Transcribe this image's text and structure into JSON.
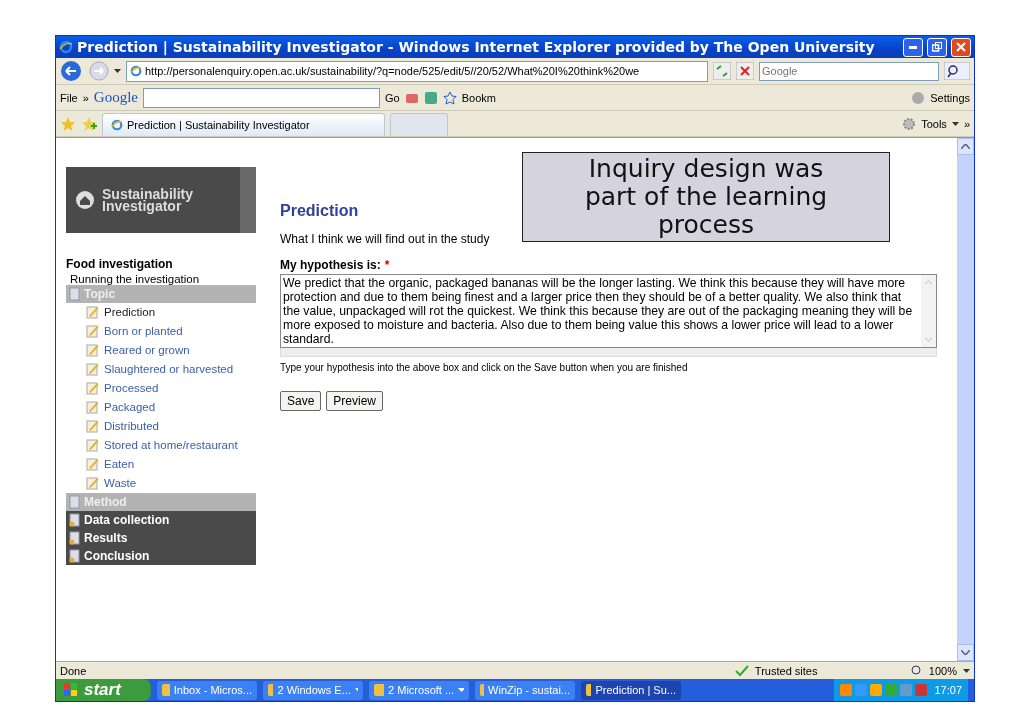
{
  "window": {
    "title": "Prediction | Sustainability Investigator - Windows Internet Explorer provided by The Open University"
  },
  "address_bar": {
    "url": "http://personalenquiry.open.ac.uk/sustainability/?q=node/525/edit/5//20/52/What%20I%20think%20we"
  },
  "search_field": {
    "placeholder": "Google"
  },
  "google_toolbar": {
    "menu": "File",
    "chevron": "»",
    "logo": "Google",
    "go": "Go",
    "bookmarks": "Bookm",
    "settings": "Settings"
  },
  "tabs": [
    {
      "label": "Prediction | Sustainability Investigator",
      "selected": true
    }
  ],
  "command_bar": {
    "tools": "Tools",
    "chevron": "»"
  },
  "sidebar": {
    "logo": "Sustainability Investigator",
    "project": "Food investigation",
    "subtitle": "Running the investigation",
    "sections": [
      {
        "label": "Topic",
        "kind": "open",
        "children": [
          {
            "label": "Prediction",
            "selected": true
          },
          {
            "label": "Born or planted",
            "selected": false
          },
          {
            "label": "Reared or grown",
            "selected": false
          },
          {
            "label": "Slaughtered or harvested",
            "selected": false
          },
          {
            "label": "Processed",
            "selected": false
          },
          {
            "label": "Packaged",
            "selected": false
          },
          {
            "label": "Distributed",
            "selected": false
          },
          {
            "label": "Stored at home/restaurant",
            "selected": false
          },
          {
            "label": "Eaten",
            "selected": false
          },
          {
            "label": "Waste",
            "selected": false
          }
        ]
      },
      {
        "label": "Method",
        "kind": "open"
      },
      {
        "label": "Data collection",
        "kind": "locked"
      },
      {
        "label": "Results",
        "kind": "locked"
      },
      {
        "label": "Conclusion",
        "kind": "locked"
      }
    ]
  },
  "page": {
    "title": "Prediction",
    "description": "What I think we will find out in the study",
    "field_label": "My hypothesis is:",
    "required": "*",
    "hypothesis": "We predict that the organic, packaged bananas will be the longer lasting. We think this because they will have more protection and due to them being finest and a larger price then they should be of a better quality. We also think that the value, unpackaged will rot the quickest. We think this because they are out of the packaging meaning they will be more exposed to moisture and bacteria. Also due to them being value this shows a lower price will lead to a lower standard.",
    "help": "Type your hypothesis into the above box and click on the Save button when you are finished",
    "buttons": [
      "Save",
      "Preview"
    ]
  },
  "status_bar": {
    "status": "Done",
    "zone": "Trusted sites",
    "zoom": "100%"
  },
  "taskbar": {
    "start": "start",
    "items": [
      {
        "label": "Inbox - Micros...",
        "selected": false,
        "dropdown": false
      },
      {
        "label": "2 Windows E...",
        "selected": false,
        "dropdown": true
      },
      {
        "label": "2 Microsoft ...",
        "selected": false,
        "dropdown": true
      },
      {
        "label": "WinZip - sustai...",
        "selected": false,
        "dropdown": false
      },
      {
        "label": "Prediction | Su...",
        "selected": true,
        "dropdown": false
      }
    ],
    "clock": "17:07"
  },
  "callout": {
    "text": "Inquiry design was part of the learning process"
  }
}
